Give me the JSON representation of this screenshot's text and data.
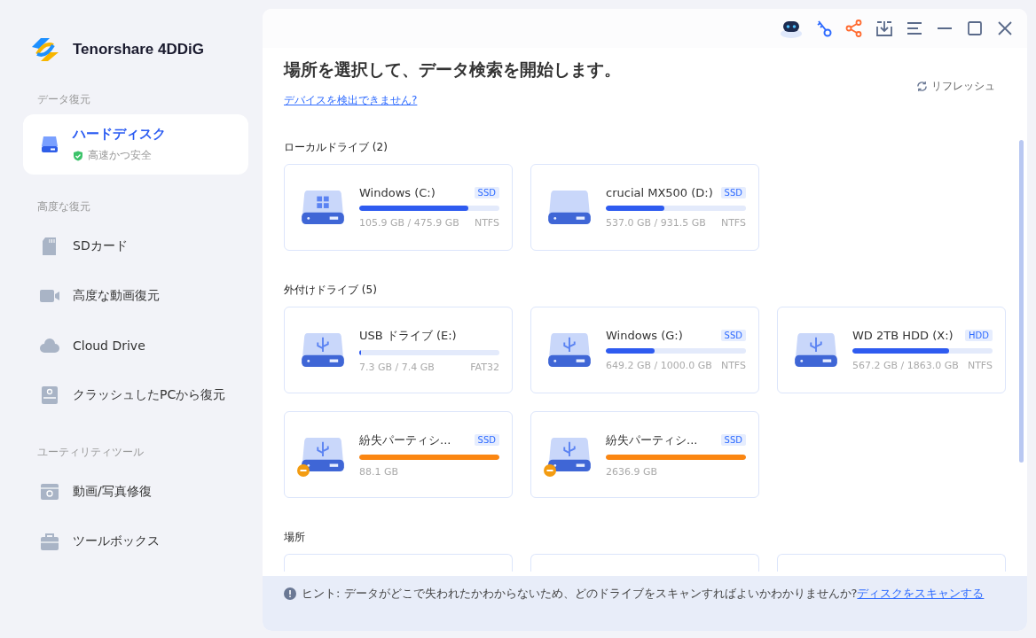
{
  "app": {
    "name": "Tenorshare 4DDiG"
  },
  "sidebar": {
    "sections": [
      {
        "label": "データ復元",
        "items": [
          {
            "label": "ハードディスク",
            "subtitle": "高速かつ安全",
            "kind": "disk",
            "selected": true
          }
        ]
      },
      {
        "label": "高度な復元",
        "items": [
          {
            "label": "SDカード",
            "kind": "sd",
            "selected": false
          },
          {
            "label": "高度な動画復元",
            "kind": "video",
            "selected": false
          },
          {
            "label": "Cloud Drive",
            "kind": "cloud",
            "selected": false
          },
          {
            "label": "クラッシュしたPCから復元",
            "kind": "crash",
            "selected": false
          }
        ]
      },
      {
        "label": "ユーティリティツール",
        "items": [
          {
            "label": "動画/写真修復",
            "kind": "repair",
            "selected": false
          },
          {
            "label": "ツールボックス",
            "kind": "toolbox",
            "selected": false
          }
        ]
      }
    ]
  },
  "main": {
    "title": "場所を選択して、データ検索を開始します。",
    "help_link": "デバイスを検出できません?",
    "refresh": "リフレッシュ",
    "groups": [
      {
        "label": "ローカルドライブ (2)",
        "drives": [
          {
            "name": "Windows (C:)",
            "type": "SSD",
            "kind": "system",
            "lost": false,
            "level": 0.78,
            "usage": "105.9 GB / 475.9 GB",
            "fs": "NTFS"
          },
          {
            "name": "crucial MX500 (D:)",
            "type": "SSD",
            "kind": "local",
            "lost": false,
            "level": 0.42,
            "usage": "537.0 GB / 931.5 GB",
            "fs": "NTFS"
          }
        ]
      },
      {
        "label": "外付けドライブ (5)",
        "drives": [
          {
            "name": "USB ドライブ (E:)",
            "kind": "usb",
            "lost": false,
            "level": 0.01,
            "usage": "7.3 GB / 7.4 GB",
            "fs": "FAT32"
          },
          {
            "name": "Windows (G:)",
            "type": "SSD",
            "kind": "usb",
            "lost": false,
            "level": 0.35,
            "usage": "649.2 GB / 1000.0 GB",
            "fs": "NTFS"
          },
          {
            "name": "WD 2TB HDD (X:)",
            "type": "HDD",
            "kind": "usb",
            "lost": false,
            "level": 0.69,
            "usage": "567.2 GB / 1863.0 GB",
            "fs": "NTFS"
          },
          {
            "name": "紛失パーティシ...",
            "type": "SSD",
            "kind": "usb",
            "lost": true,
            "level": 1,
            "usage": "88.1 GB"
          },
          {
            "name": "紛失パーティシ...",
            "type": "SSD",
            "kind": "usb",
            "lost": true,
            "level": 1,
            "usage": "2636.9 GB"
          }
        ]
      },
      {
        "label": "場所",
        "drives": [
          {
            "kind": "location"
          },
          {
            "kind": "location"
          },
          {
            "kind": "location"
          }
        ]
      }
    ],
    "hint": {
      "text": "ヒント:  データがどこで失われたかわからないため、どのドライブをスキャンすればよいかわかりませんか?",
      "link": "ディスクをスキャンする"
    }
  }
}
